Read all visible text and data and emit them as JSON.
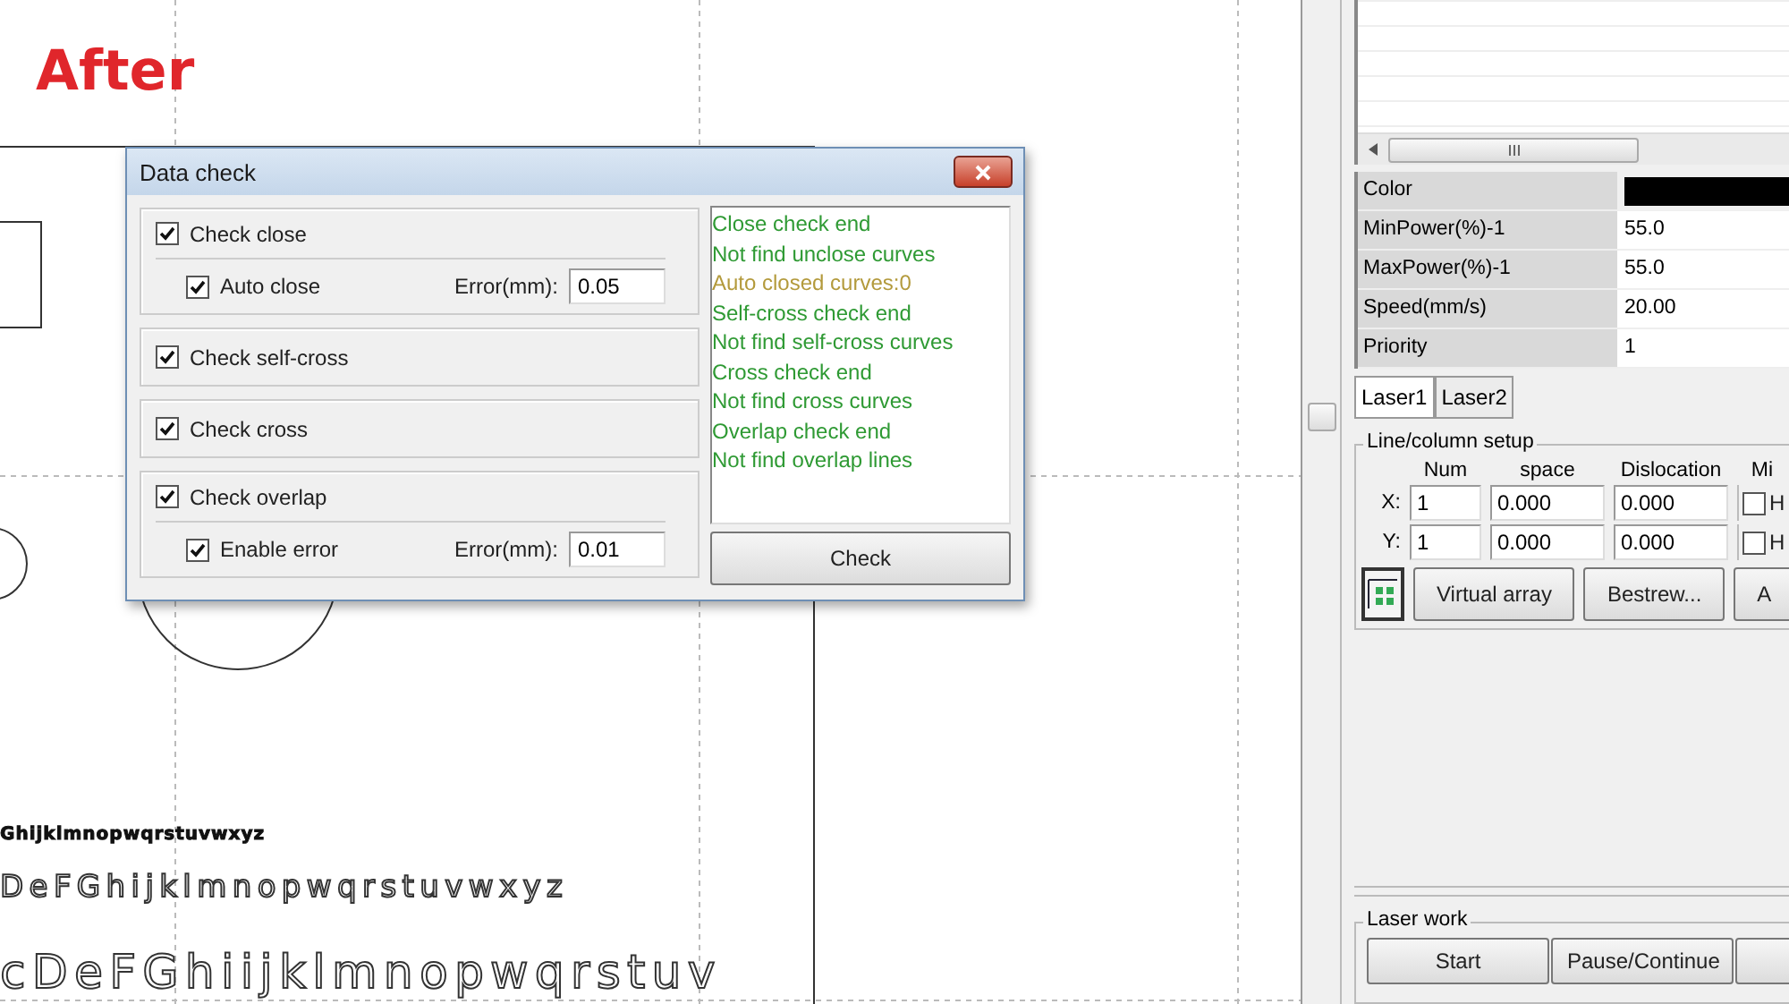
{
  "annotation": "After",
  "canvas_texts": [
    {
      "text": "Ghijklmnopwqrstuvwxyz",
      "kind": "small"
    },
    {
      "text": "DeFGhijklmnopwqrstuvwxyz",
      "kind": "medium"
    },
    {
      "text": "cDeFGhiijklmnopwqrstuv",
      "kind": "large"
    }
  ],
  "dialog": {
    "title": "Data check",
    "groups": [
      {
        "label": "Check close",
        "checked": true,
        "sub": {
          "label": "Auto close",
          "checked": true,
          "error_label": "Error(mm):",
          "error_value": "0.05"
        }
      },
      {
        "label": "Check self-cross",
        "checked": true
      },
      {
        "label": "Check cross",
        "checked": true
      },
      {
        "label": "Check overlap",
        "checked": true,
        "sub": {
          "label": "Enable error",
          "checked": true,
          "error_label": "Error(mm):",
          "error_value": "0.01"
        }
      }
    ],
    "log": [
      {
        "text": "Close check end",
        "color": "#2f9a34"
      },
      {
        "text": "Not find unclose curves",
        "color": "#2f9a34"
      },
      {
        "text": "Auto closed curves:0",
        "color": "#b39a3c"
      },
      {
        "text": "Self-cross check end",
        "color": "#2f9a34"
      },
      {
        "text": "Not find self-cross curves",
        "color": "#2f9a34"
      },
      {
        "text": "Cross check end",
        "color": "#2f9a34"
      },
      {
        "text": "Not find cross curves",
        "color": "#2f9a34"
      },
      {
        "text": "Overlap check end",
        "color": "#2f9a34"
      },
      {
        "text": "Not find overlap lines",
        "color": "#2f9a34"
      }
    ],
    "check_button": "Check"
  },
  "properties": [
    {
      "name": "Color",
      "kind": "swatch",
      "color": "#000000"
    },
    {
      "name": "MinPower(%)-1",
      "kind": "text",
      "value": "55.0"
    },
    {
      "name": "MaxPower(%)-1",
      "kind": "text",
      "value": "55.0"
    },
    {
      "name": "Speed(mm/s)",
      "kind": "text",
      "value": "20.00"
    },
    {
      "name": "Priority",
      "kind": "text",
      "value": "1"
    }
  ],
  "tabs": [
    {
      "label": "Laser1",
      "selected": true
    },
    {
      "label": "Laser2",
      "selected": false
    }
  ],
  "line_column_setup": {
    "title": "Line/column setup",
    "columns": [
      "Num",
      "space",
      "Dislocation",
      "Mi"
    ],
    "rows": [
      {
        "label": "X:",
        "num": "1",
        "space": "0.000",
        "dislocation": "0.000",
        "check_label": "H",
        "checked": false
      },
      {
        "label": "Y:",
        "num": "1",
        "space": "0.000",
        "dislocation": "0.000",
        "check_label": "H",
        "checked": false
      }
    ],
    "buttons": [
      "Virtual array",
      "Bestrew...",
      "A"
    ]
  },
  "laser_work": {
    "title": "Laser work",
    "buttons": [
      "Start",
      "Pause/Continue"
    ]
  }
}
